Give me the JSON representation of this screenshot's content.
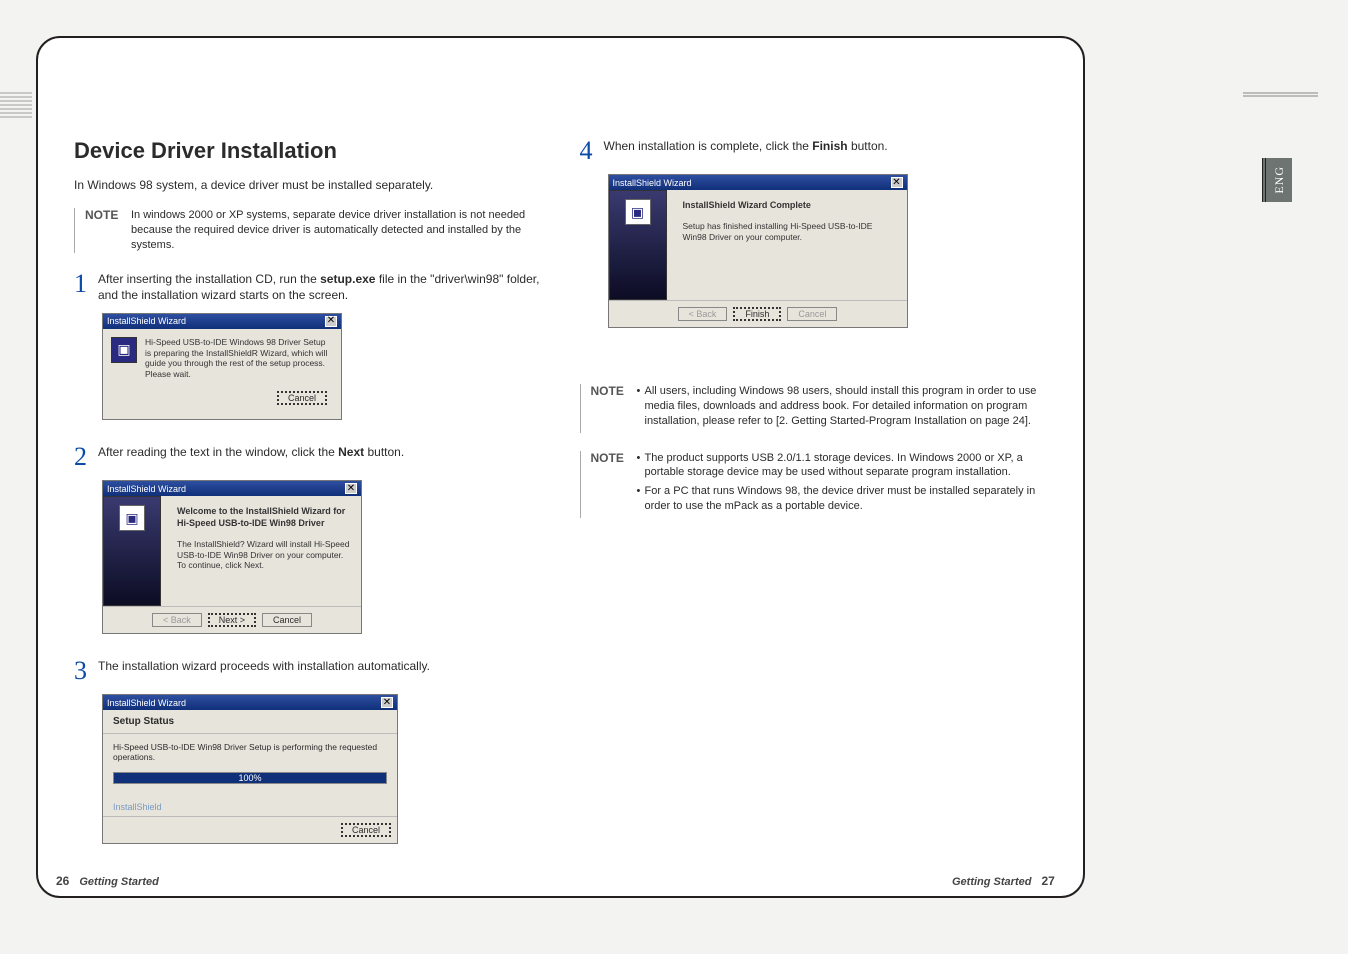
{
  "left": {
    "heading": "Device Driver Installation",
    "intro": "In Windows 98 system, a device driver must be installed separately.",
    "topnote_label": "NOTE",
    "topnote_body": "In windows 2000 or XP systems, separate device driver installation is not needed because the required device driver is automatically detected and installed by the systems.",
    "step1_num": "1",
    "step1_a": "After inserting the installation CD, run the ",
    "step1_b": "setup.exe",
    "step1_c": " file in the \"driver\\win98\" folder, and the installation wizard starts on the screen.",
    "step2_num": "2",
    "step2_a": "After reading the text in the window, click the ",
    "step2_b": "Next",
    "step2_c": " button.",
    "step3_num": "3",
    "step3_text": "The installation wizard proceeds with installation automatically."
  },
  "right": {
    "step4_num": "4",
    "step4_a": "When installation is complete, click the ",
    "step4_b": "Finish",
    "step4_c": " button.",
    "note1_label": "NOTE",
    "note1_li1": "All users, including Windows 98 users, should install this program in order to use media files, downloads and address book. For detailed information on program installation, please refer to [2. Getting Started-Program Installation on page 24].",
    "note2_label": "NOTE",
    "note2_li1": "The product supports USB 2.0/1.1 storage devices. In Windows 2000 or XP, a portable storage device may be used without separate program installation.",
    "note2_li2": "For a PC that runs Windows 98, the device driver must be installed separately in order to use the mPack as a portable device."
  },
  "wizard": {
    "title": "InstallShield Wizard",
    "close_glyph": "✕",
    "preparing": "Hi-Speed USB-to-IDE Windows 98 Driver Setup is preparing the InstallShieldR Wizard, which will guide you through the rest of the setup process. Please wait.",
    "cancel": "Cancel",
    "welcome_bold": "Welcome to the InstallShield Wizard for Hi-Speed USB-to-IDE Win98 Driver",
    "welcome_body": "The InstallShield? Wizard will install Hi-Speed USB-to-IDE Win98 Driver on your computer.  To continue, click Next.",
    "back": "< Back",
    "next": "Next >",
    "setup_status": "Setup Status",
    "status_line": "Hi-Speed USB-to-IDE Win98 Driver Setup is performing the requested operations.",
    "progress": "100%",
    "brand": "InstallShield",
    "complete_bold": "InstallShield Wizard Complete",
    "complete_body": "Setup has finished installing Hi-Speed USB-to-IDE Win98 Driver on your computer.",
    "finish": "Finish"
  },
  "footer": {
    "left_num": "26",
    "left_section": "Getting Started",
    "right_section": "Getting Started",
    "right_num": "27"
  },
  "sidetab": "ENG"
}
